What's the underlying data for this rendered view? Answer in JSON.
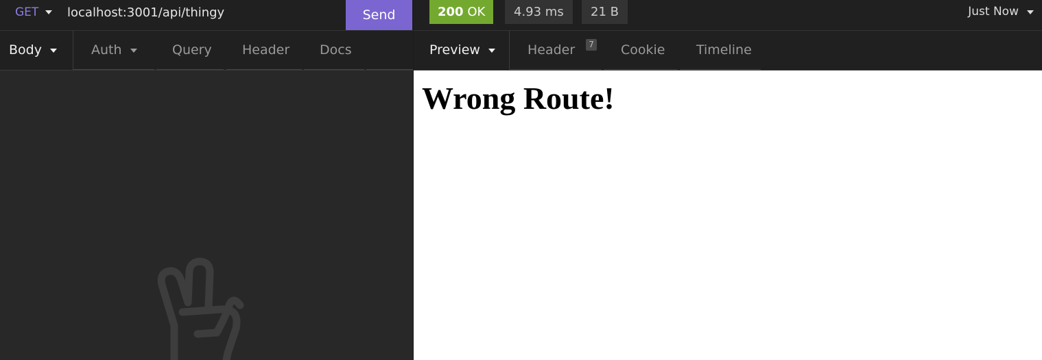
{
  "request": {
    "method": "GET",
    "url": "localhost:3001/api/thingy",
    "send_label": "Send"
  },
  "left_tabs": [
    {
      "label": "Body",
      "has_dropdown": true,
      "active": true
    },
    {
      "label": "Auth",
      "has_dropdown": true,
      "active": false
    },
    {
      "label": "Query",
      "has_dropdown": false,
      "active": false
    },
    {
      "label": "Header",
      "has_dropdown": false,
      "active": false
    },
    {
      "label": "Docs",
      "has_dropdown": false,
      "active": false
    }
  ],
  "response": {
    "status_code": "200",
    "status_text": "OK",
    "time": "4.93 ms",
    "size": "21 B",
    "timestamp": "Just Now"
  },
  "right_tabs": [
    {
      "label": "Preview",
      "has_dropdown": true,
      "active": true
    },
    {
      "label": "Header",
      "badge": "7",
      "active": false
    },
    {
      "label": "Cookie",
      "active": false
    },
    {
      "label": "Timeline",
      "active": false
    }
  ],
  "preview": {
    "heading": "Wrong Route!"
  },
  "colors": {
    "accent": "#7b65d0",
    "method": "#8d7ee0",
    "status_ok": "#74a92f",
    "background": "#282828",
    "preview_bg": "#ffffff"
  },
  "icons": {
    "empty_body": "peace-hand-icon"
  }
}
